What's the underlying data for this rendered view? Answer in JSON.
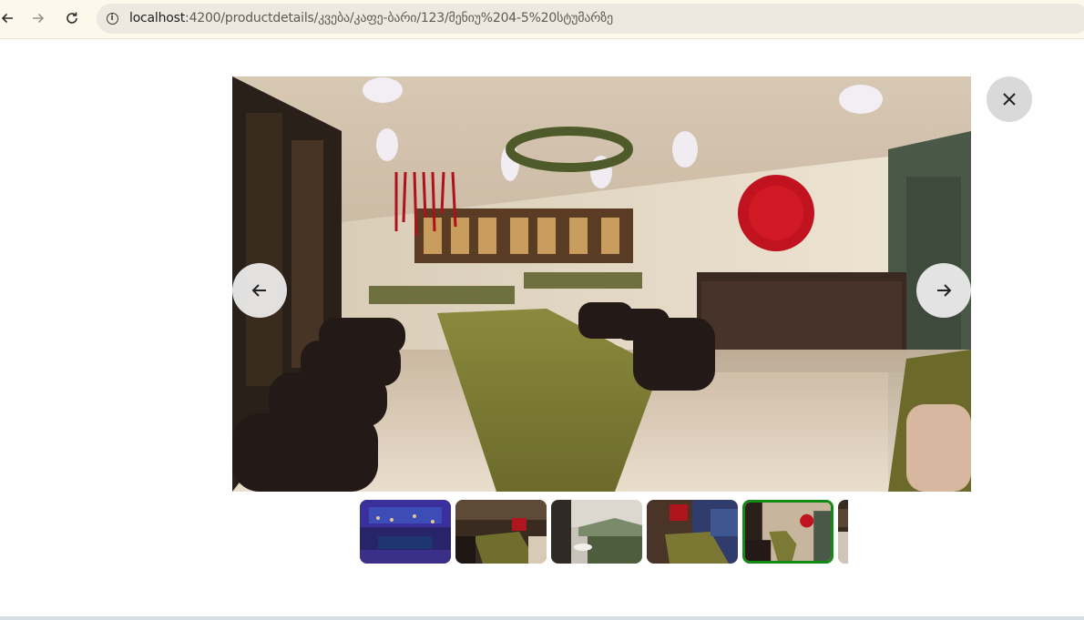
{
  "browser": {
    "back_icon": "arrow-left-icon",
    "forward_icon": "arrow-right-icon",
    "reload_icon": "reload-icon",
    "site_info_icon": "info-icon",
    "url_host": "localhost",
    "url_path": ":4200/productdetails/კვება/კაფე-ბარი/123/მენიუ%204-5%20სტუმარზე"
  },
  "gallery": {
    "prev_icon": "arrow-left-icon",
    "next_icon": "arrow-right-icon",
    "close_icon": "close-icon",
    "thumbnail_count": 6,
    "active_thumbnail_index": 4,
    "active_border_color": "#138a13"
  }
}
